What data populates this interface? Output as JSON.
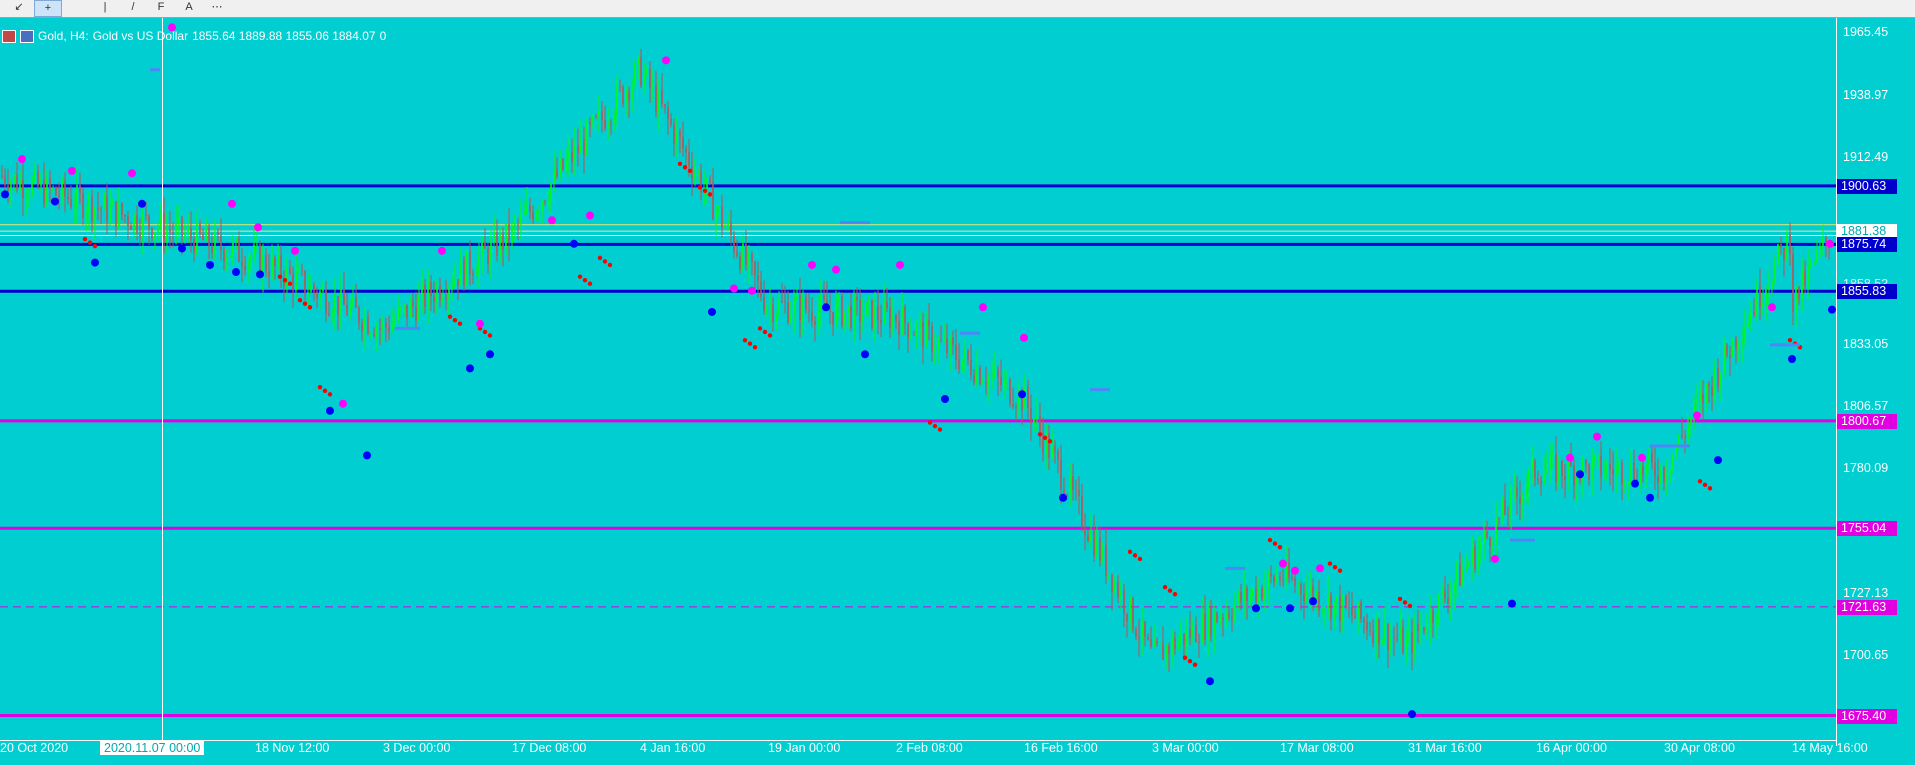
{
  "toolbar": {
    "buttons": [
      {
        "name": "back-arrow-icon",
        "glyph": "↙"
      },
      {
        "name": "crosshair-cursor-icon",
        "glyph": "+"
      },
      {
        "name": "vertical-line-tool-icon",
        "glyph": "|"
      },
      {
        "name": "trendline-tool-icon",
        "glyph": "/"
      },
      {
        "name": "fibonacci-tool-icon",
        "glyph": "F"
      },
      {
        "name": "text-tool-icon",
        "glyph": "A"
      },
      {
        "name": "dotted-line-tool-icon",
        "glyph": "⋯"
      }
    ]
  },
  "chart_header": {
    "symbol": "Gold, H4:",
    "description": "Gold vs US Dollar",
    "ohlc": "1855.64 1889.88 1855.06 1884.07",
    "volume": "0"
  },
  "price_axis": {
    "ticks": [
      "1965.45",
      "1938.97",
      "1912.49",
      "1806.57",
      "1780.09",
      "1727.13",
      "1700.65",
      "1833.05"
    ],
    "levels": [
      {
        "value": "1900.63",
        "color": "#0000CD",
        "text_color": "#FFFFFF"
      },
      {
        "value": "1881.38",
        "color": "#FFFFFF",
        "text_color": "#00A9AD"
      },
      {
        "value": "1875.74",
        "color": "#0000CD",
        "text_color": "#FFFFFF"
      },
      {
        "value": "1855.83",
        "color": "#0000CD",
        "text_color": "#FFFFFF"
      },
      {
        "value": "1800.67",
        "color": "#E000E0",
        "text_color": "#FFFFFF"
      },
      {
        "value": "1755.04",
        "color": "#E000E0",
        "text_color": "#FFFFFF"
      },
      {
        "value": "1721.63",
        "color": "#E000E0",
        "text_color": "#FFFFFF"
      },
      {
        "value": "1675.40",
        "color": "#E000E0",
        "text_color": "#FFFFFF"
      }
    ],
    "partial_ticks": [
      "1858.53"
    ]
  },
  "time_axis": {
    "labels": [
      "20 Oct 2020",
      "18 Nov 12:00",
      "3 Dec 00:00",
      "17 Dec 08:00",
      "4 Jan 16:00",
      "19 Jan 00:00",
      "2 Feb 08:00",
      "16 Feb 16:00",
      "3 Mar 00:00",
      "17 Mar 08:00",
      "31 Mar 16:00",
      "16 Apr 00:00",
      "30 Apr 08:00",
      "14 May 16:00"
    ],
    "crosshair_label": "2020.11.07 00:00"
  },
  "colors": {
    "background": "#00CED1",
    "support_resistance_blue": "#0000CD",
    "support_resistance_magenta": "#E000E0",
    "bull_candle": "#00FF00",
    "bear_candle": "#C05050",
    "stop_dot_red": "#FF0000",
    "signal_blue": "#0000FF",
    "signal_magenta": "#FF00FF",
    "trail_line": "#4F86F7"
  },
  "chart_data": {
    "type": "candlestick",
    "symbol": "Gold",
    "timeframe": "H4",
    "ylim": [
      1665,
      1972
    ],
    "grid": false,
    "price_series_approx": [
      [
        "20 Oct 2020",
        1905
      ],
      [
        "18 Nov 12:00",
        1870
      ],
      [
        "3 Dec 00:00",
        1840
      ],
      [
        "17 Dec 08:00",
        1880
      ],
      [
        "4 Jan 16:00",
        1950
      ],
      [
        "19 Jan 00:00",
        1850
      ],
      [
        "2 Feb 08:00",
        1845
      ],
      [
        "16 Feb 16:00",
        1810
      ],
      [
        "3 Mar 00:00",
        1700
      ],
      [
        "17 Mar 08:00",
        1735
      ],
      [
        "31 Mar 16:00",
        1705
      ],
      [
        "16 Apr 00:00",
        1780
      ],
      [
        "30 Apr 08:00",
        1780
      ],
      [
        "14 May 16:00",
        1880
      ]
    ],
    "horizontal_levels": [
      1900.63,
      1881.38,
      1875.74,
      1855.83,
      1800.67,
      1755.04,
      1721.63,
      1675.4
    ]
  }
}
